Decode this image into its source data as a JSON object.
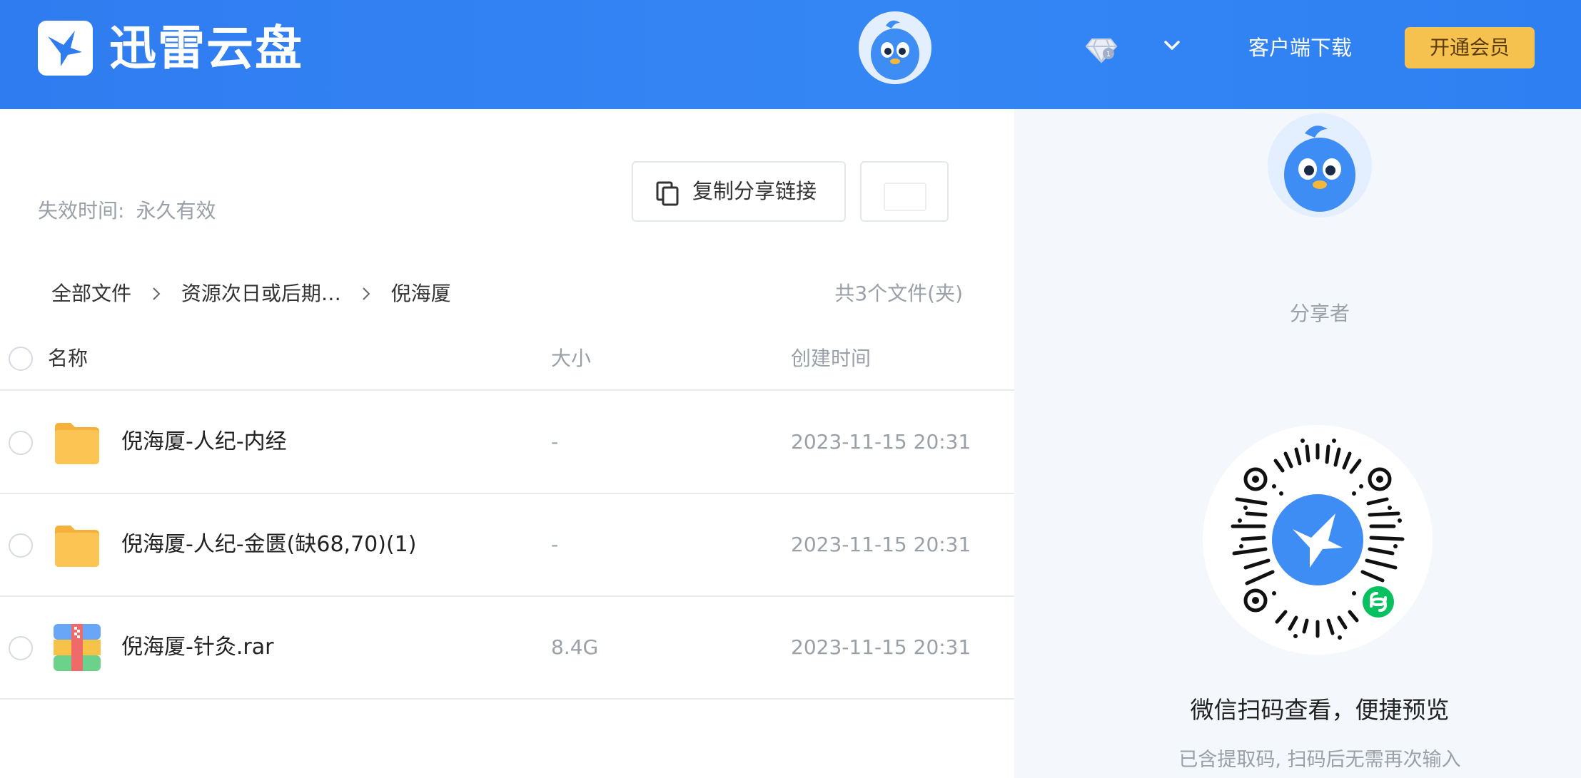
{
  "header": {
    "logo_text": "迅雷云盘",
    "client_download": "客户端下载",
    "vip_button": "开通会员",
    "icons": [
      "logo-bird-icon",
      "avatar-bird-icon",
      "diamond-icon",
      "chevron-down-icon"
    ]
  },
  "share": {
    "expire_label": "失效时间:",
    "expire_value": "永久有效",
    "copy_link_label": "复制分享链接"
  },
  "breadcrumb": {
    "items": [
      "全部文件",
      "资源次日或后期…",
      "倪海厦"
    ],
    "file_count": "共3个文件(夹)"
  },
  "table": {
    "columns": {
      "name": "名称",
      "size": "大小",
      "time": "创建时间"
    },
    "rows": [
      {
        "name": "倪海厦-人纪-内经",
        "size": "-",
        "time": "2023-11-15 20:31",
        "type": "folder"
      },
      {
        "name": "倪海厦-人纪-金匮(缺68,70)(1)",
        "size": "-",
        "time": "2023-11-15 20:31",
        "type": "folder"
      },
      {
        "name": "倪海厦-针灸.rar",
        "size": "8.4G",
        "time": "2023-11-15 20:31",
        "type": "archive"
      }
    ]
  },
  "sidebar": {
    "sharer_label": "分享者",
    "qr_title": "微信扫码查看，便捷预览",
    "qr_subtitle": "已含提取码, 扫码后无需再次输入"
  },
  "colors": {
    "header_blue": "#3586f5",
    "vip_gold": "#f5c24f",
    "folder_yellow": "#fbbf4a",
    "muted_text": "#9aa0a8",
    "sidebar_bg": "#f4f7fb"
  }
}
